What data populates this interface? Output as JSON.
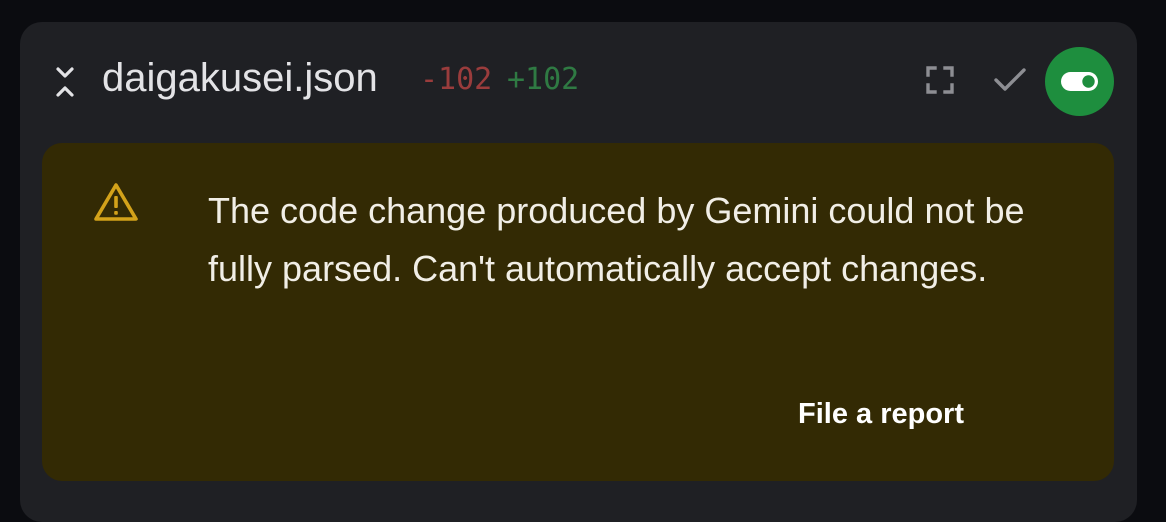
{
  "file": {
    "name": "daigakusei.json",
    "removed": "-102",
    "added": "+102"
  },
  "icons": {
    "collapse": "collapse-icon",
    "expand": "expand-icon",
    "accept": "checkmark-icon",
    "toggle": "toggle-icon",
    "warning": "warning-icon"
  },
  "warning": {
    "message": "The code change produced by Gemini could not be fully parsed. Can't automatically accept changes.",
    "action_label": "File a report"
  },
  "colors": {
    "panel_bg": "#1f2024",
    "warning_bg": "#332a04",
    "warning_icon": "#d3a21a",
    "removed": "#9a3c3c",
    "added": "#2f7a43",
    "toggle_bg": "#1e8e3e"
  }
}
